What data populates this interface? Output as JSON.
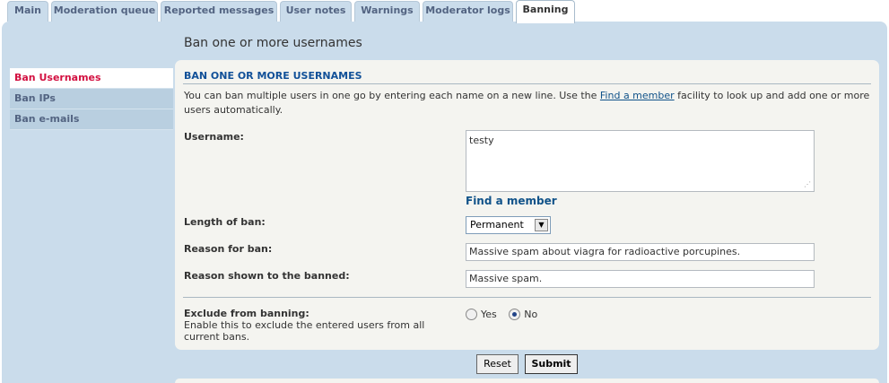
{
  "tabs": [
    {
      "label": "Main"
    },
    {
      "label": "Moderation queue"
    },
    {
      "label": "Reported messages"
    },
    {
      "label": "User notes"
    },
    {
      "label": "Warnings"
    },
    {
      "label": "Moderator logs"
    },
    {
      "label": "Banning",
      "active": true
    }
  ],
  "page": {
    "title": "Ban one or more usernames"
  },
  "sidebar": {
    "items": [
      {
        "label": "Ban Usernames",
        "active": true
      },
      {
        "label": "Ban IPs"
      },
      {
        "label": "Ban e-mails"
      }
    ]
  },
  "form": {
    "legend": "BAN ONE OR MORE USERNAMES",
    "intro_before": "You can ban multiple users in one go by entering each name on a new line. Use the ",
    "intro_link": "Find a member",
    "intro_after": " facility to look up and add one or more users automatically.",
    "username_label": "Username:",
    "username_value": "testy",
    "find_member_link": "Find a member",
    "length_label": "Length of ban:",
    "length_value": "Permanent",
    "reason_label": "Reason for ban:",
    "reason_value": "Massive spam about viagra for radioactive porcupines.",
    "reason_shown_label": "Reason shown to the banned:",
    "reason_shown_value": "Massive spam.",
    "exclude_label": "Exclude from banning:",
    "exclude_explain": "Enable this to exclude the entered users from all current bans.",
    "exclude_yes": "Yes",
    "exclude_no": "No",
    "exclude_selected": "No"
  },
  "buttons": {
    "reset": "Reset",
    "submit": "Submit"
  },
  "colors": {
    "accent": "#105289",
    "active_menu": "#d31141",
    "panel": "#cadceb"
  }
}
